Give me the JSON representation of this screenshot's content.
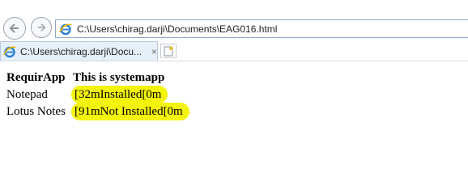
{
  "browser": {
    "address": "C:\\Users\\chirag.darji\\Documents\\EAG016.html",
    "tab_title": "C:\\Users\\chirag.darji\\Docu...",
    "tab_close": "×",
    "back_icon": "back-arrow-icon",
    "forward_icon": "forward-arrow-icon",
    "page_icon": "internet-explorer-icon",
    "new_tab_icon": "new-tab-icon"
  },
  "page": {
    "headers": [
      "RequirApp",
      "This is systemapp"
    ],
    "rows": [
      {
        "app": "Notepad",
        "status": "[32mInstalled[0m"
      },
      {
        "app": "Lotus Notes",
        "status": "[91mNot Installed[0m"
      }
    ],
    "highlight_color": "#f4f40a"
  }
}
